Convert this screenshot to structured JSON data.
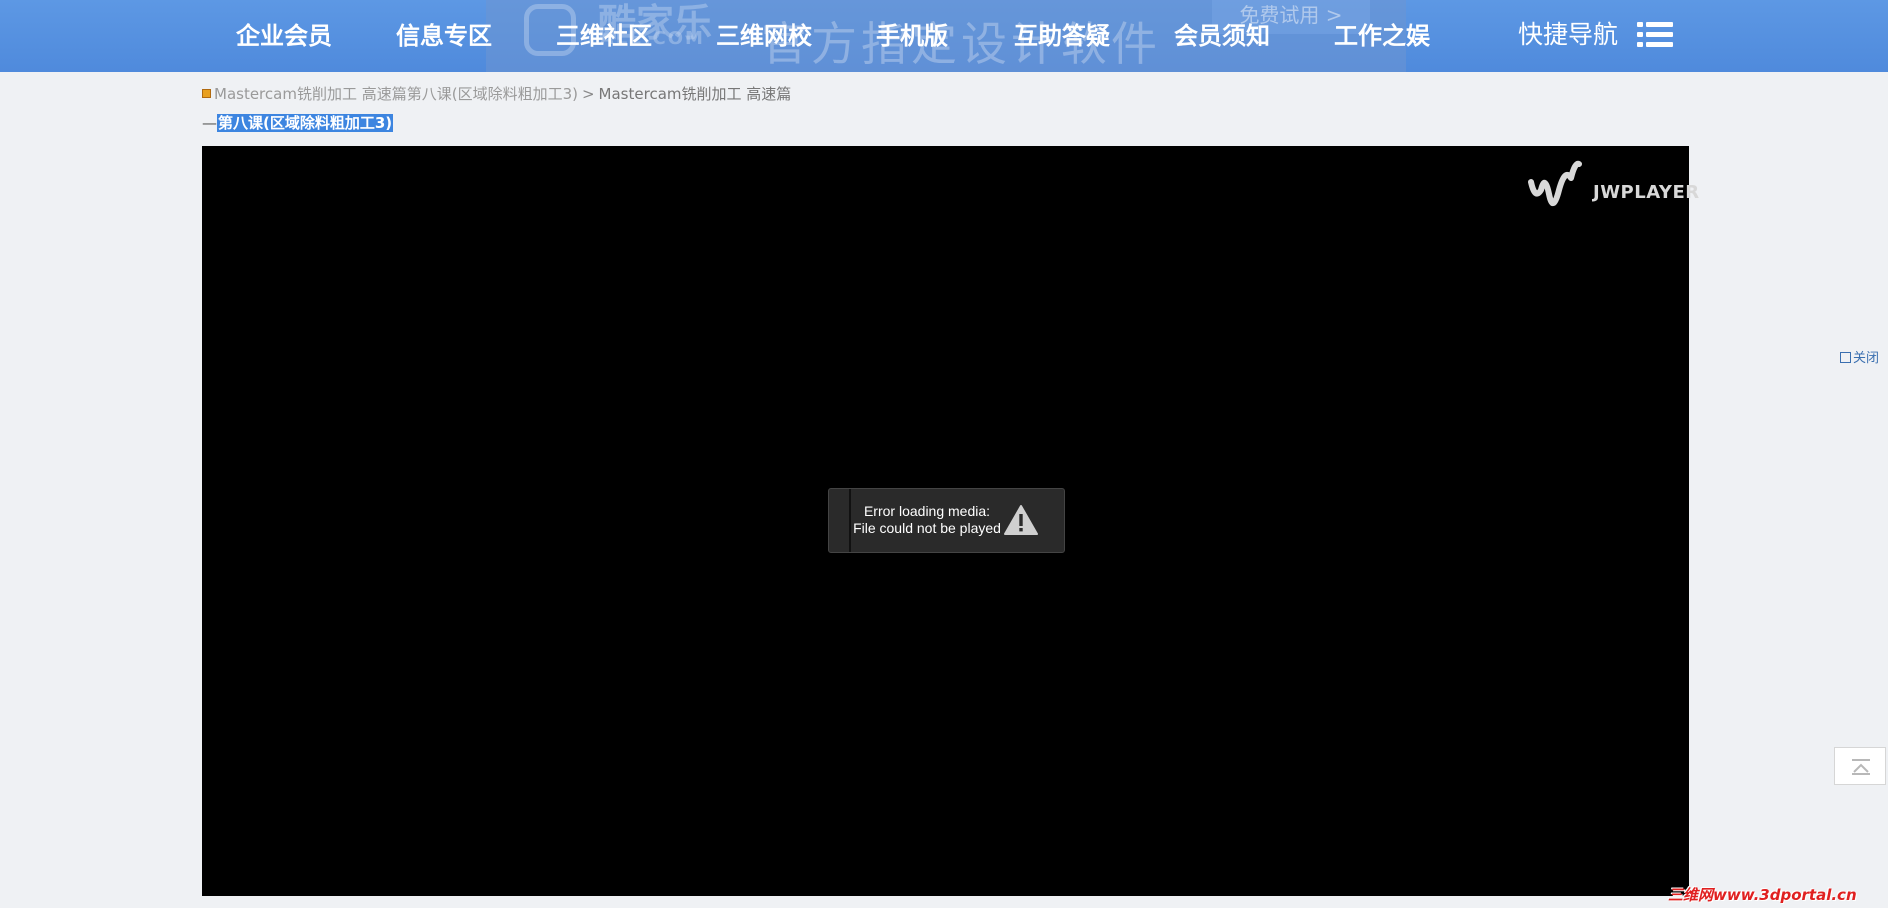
{
  "ad": {
    "logo_text": "酷家乐",
    "logo_sub": "ALE.COM",
    "slogan": "官方指定设计软件",
    "trial_label": "免费试用 >"
  },
  "nav": {
    "items": [
      {
        "label": "企业会员"
      },
      {
        "label": "信息专区"
      },
      {
        "label": "三维社区"
      },
      {
        "label": "三维网校"
      },
      {
        "label": "手机版"
      },
      {
        "label": "互助答疑"
      },
      {
        "label": "会员须知"
      },
      {
        "label": "工作之娱"
      }
    ],
    "quick_nav_label": "快捷导航"
  },
  "breadcrumb": {
    "first": "Mastercam铣削加工 高速篇第八课(区域除料粗加工3)",
    "separator": ">",
    "second": "Mastercam铣削加工 高速篇"
  },
  "subtitle": {
    "prefix": "—",
    "selected": "第八课(区域除料粗加工3)"
  },
  "player": {
    "brand": "JWPLAYER",
    "error_line1": "Error loading media:",
    "error_line2": "File could not be played"
  },
  "side": {
    "close_label": "关闭"
  },
  "watermark": "三维网www.3dportal.cn",
  "colors": {
    "nav_bg": "#4f8adc",
    "page_bg": "#eff1f4",
    "selection": "#3d85e0",
    "watermark": "#e02020"
  }
}
